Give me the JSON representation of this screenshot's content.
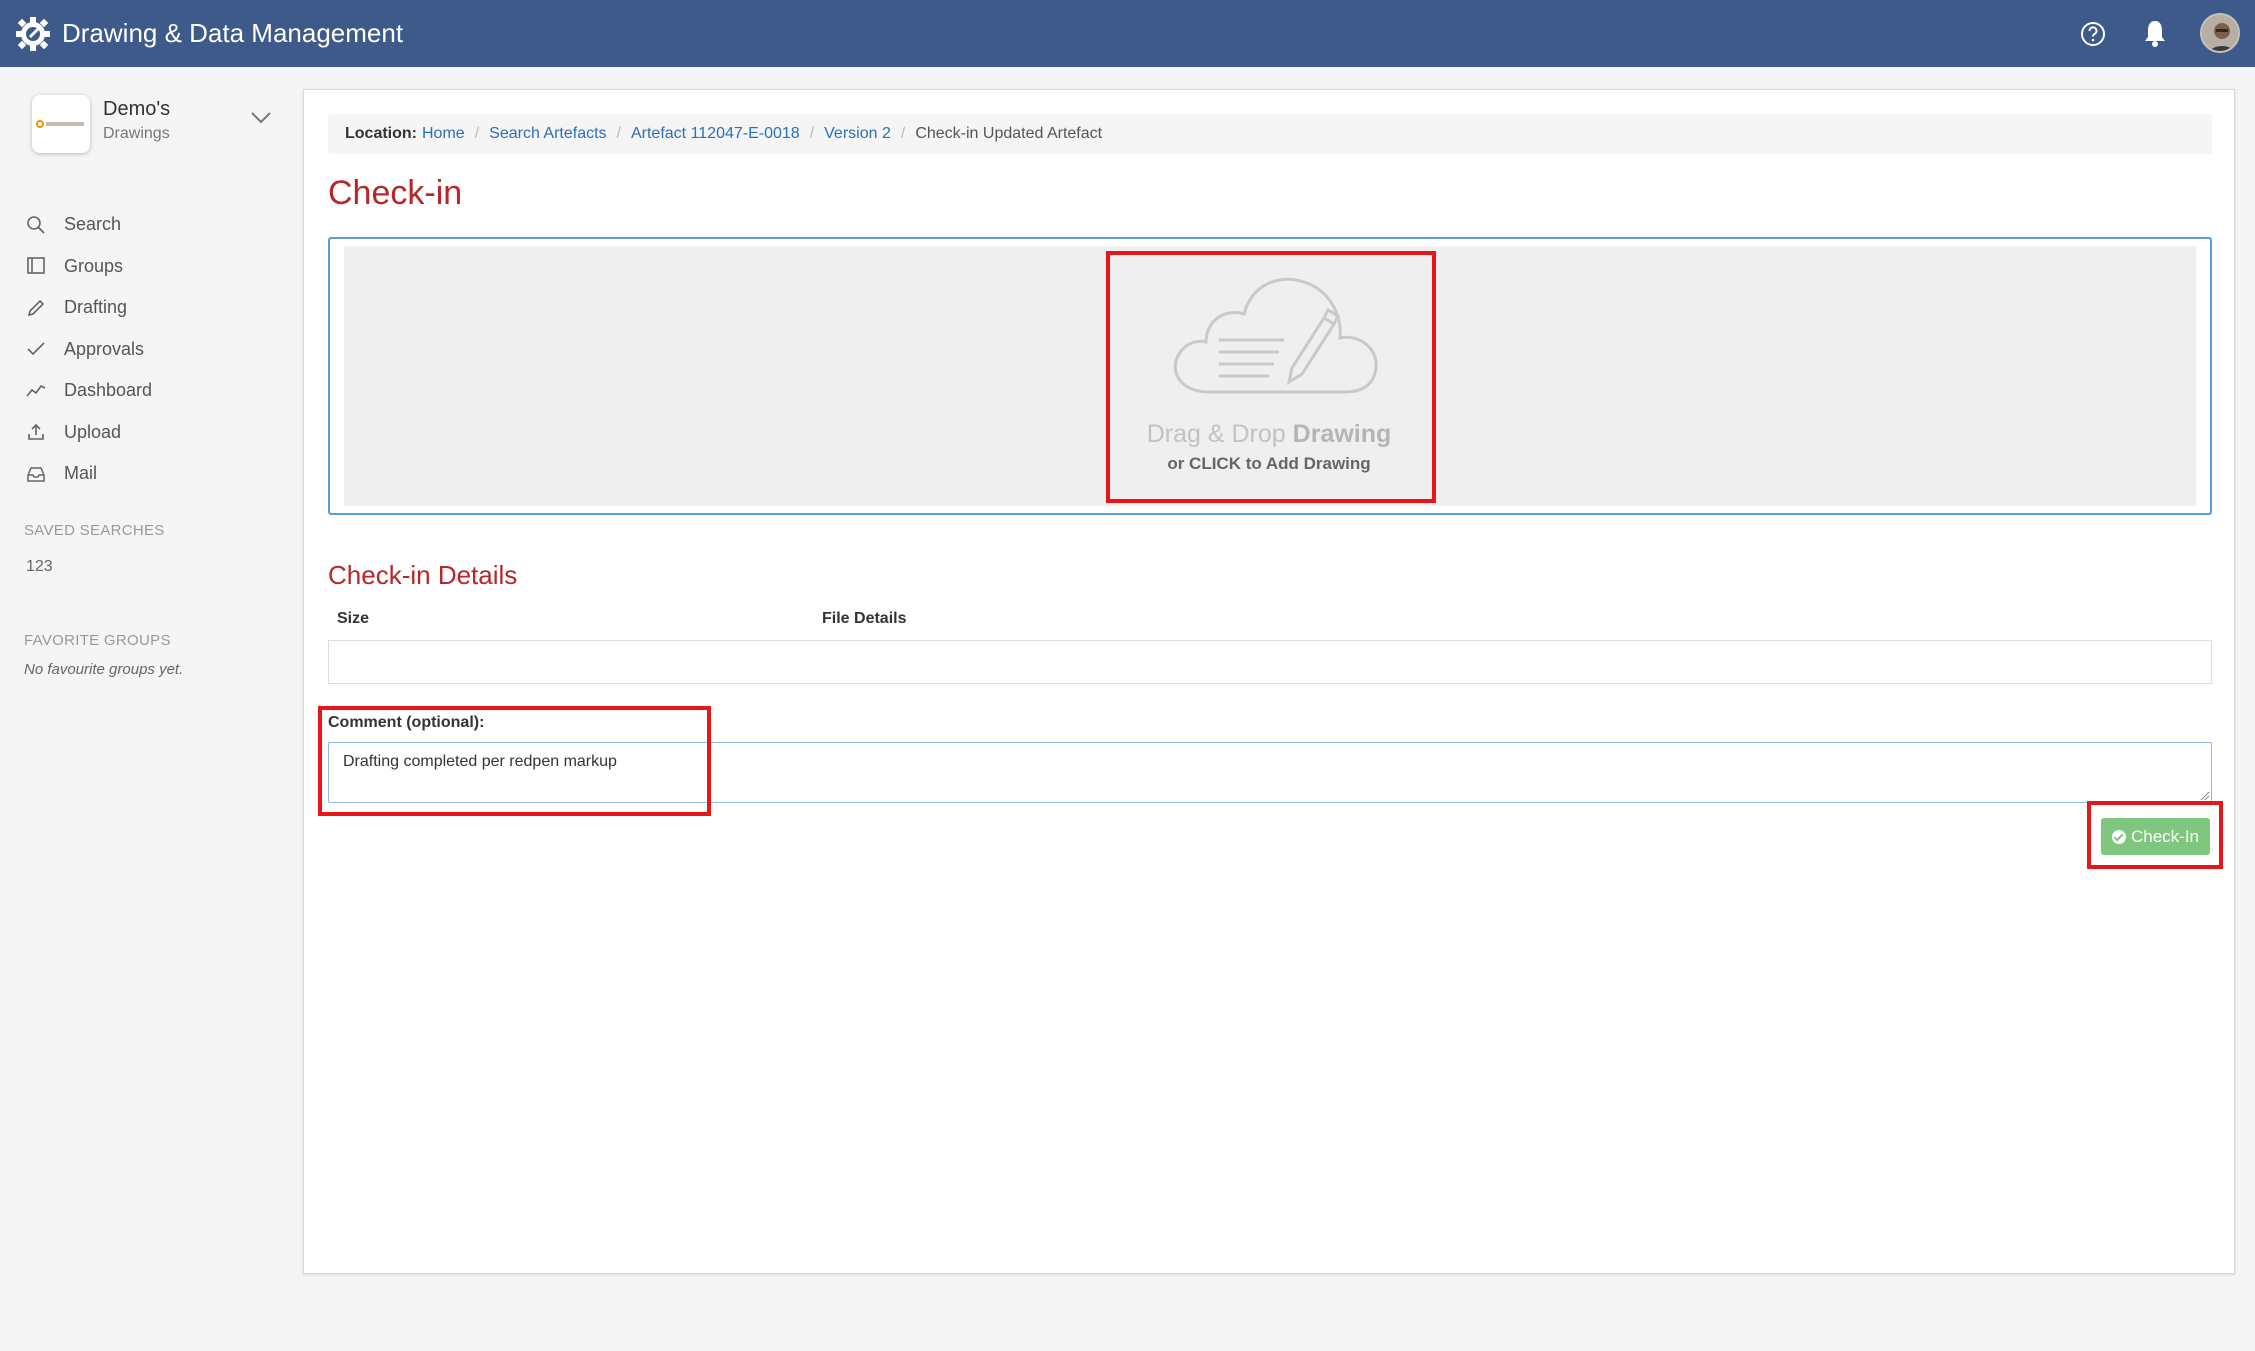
{
  "header": {
    "title": "Drawing & Data Management",
    "icons": [
      "gear-logo-icon",
      "help-icon",
      "bell-icon",
      "avatar"
    ]
  },
  "sidebar": {
    "tenant_name": "Demo's",
    "tenant_sub": "Drawings",
    "nav": [
      {
        "label": "Search",
        "icon": "search-icon"
      },
      {
        "label": "Groups",
        "icon": "book-icon"
      },
      {
        "label": "Drafting",
        "icon": "pencil-icon"
      },
      {
        "label": "Approvals",
        "icon": "check-icon"
      },
      {
        "label": "Dashboard",
        "icon": "chart-line-icon"
      },
      {
        "label": "Upload",
        "icon": "upload-icon"
      },
      {
        "label": "Mail",
        "icon": "inbox-icon"
      }
    ],
    "saved_searches_heading": "SAVED SEARCHES",
    "saved_search_1": "123",
    "favorite_groups_heading": "FAVORITE GROUPS",
    "favorite_groups_empty": "No favourite groups yet."
  },
  "breadcrumb": {
    "label": "Location:",
    "items": [
      "Home",
      "Search Artefacts",
      "Artefact 112047-E-0018",
      "Version 2"
    ],
    "current": "Check-in Updated Artefact"
  },
  "main": {
    "title": "Check-in",
    "dropzone_title_light": "Drag & Drop",
    "dropzone_title_bold": "Drawing",
    "dropzone_sub": "or CLICK to Add Drawing",
    "details_title": "Check-in Details",
    "col_size": "Size",
    "col_file_details": "File Details",
    "comment_label": "Comment (optional):",
    "comment_value": "Drafting completed per redpen markup",
    "checkin_button": "Check-In"
  },
  "colors": {
    "header_bg": "#3e5a8a",
    "title_red": "#b8262a",
    "link_blue": "#2a6fb8",
    "button_green": "#7fc77f",
    "annotation_red": "#e8151a"
  }
}
